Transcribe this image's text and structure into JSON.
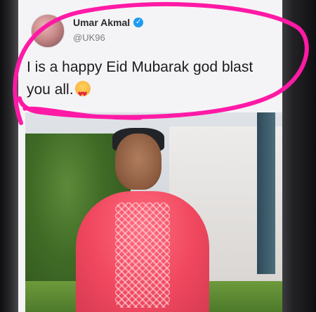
{
  "tweet": {
    "display_name": "Umar Akmal",
    "handle": "@UK96",
    "verified_icon": "verified-badge-icon",
    "text": "I is a happy Eid Mubarak god blast you all.",
    "emoji_icon": "heart-eyes-emoji-icon"
  },
  "photo": {
    "subject_icon": "tweet-photo"
  },
  "colors": {
    "annotation": "#ff1aa6",
    "verified": "#1d9bf0"
  }
}
